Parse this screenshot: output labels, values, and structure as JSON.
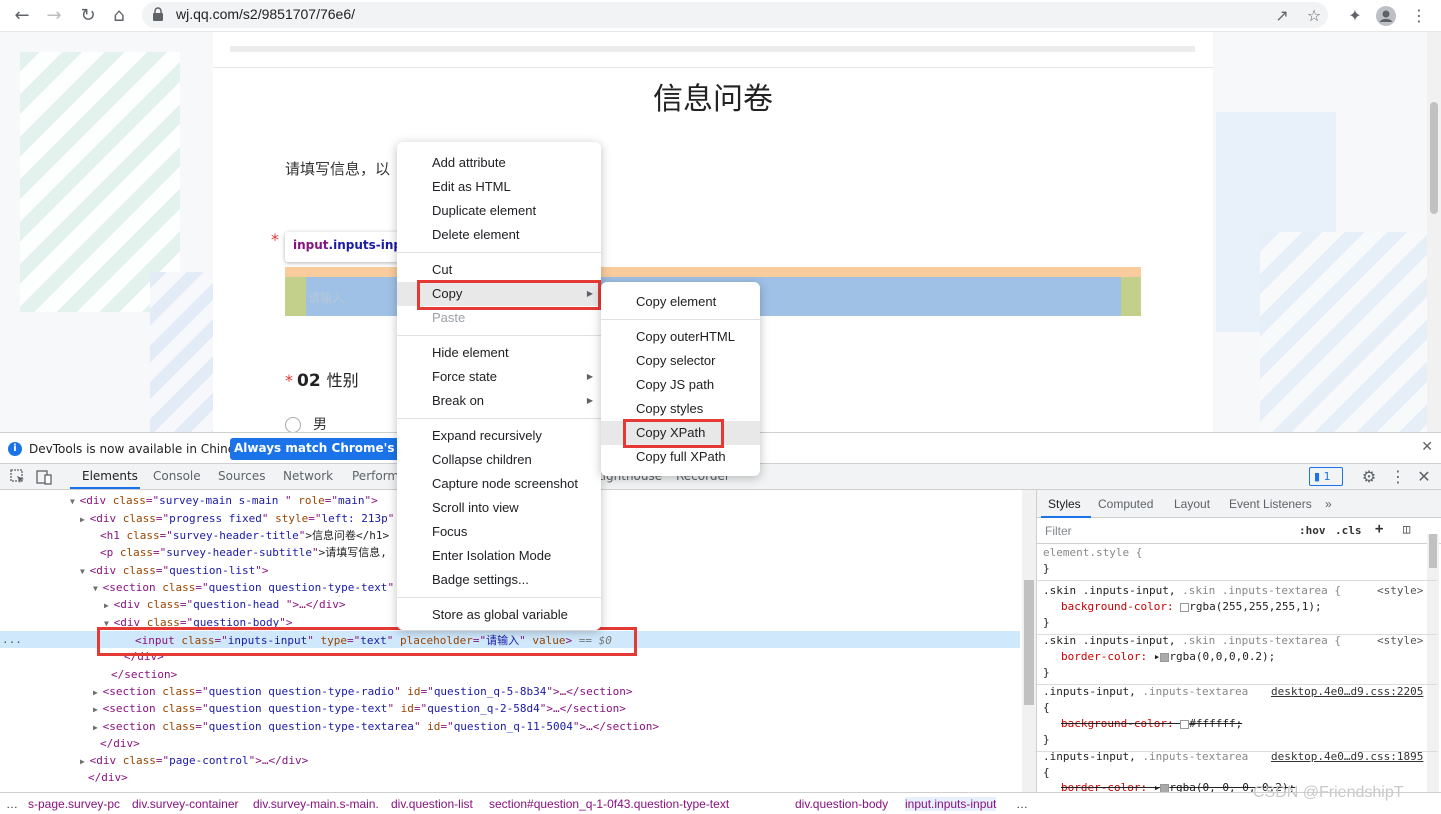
{
  "browser": {
    "url": "wj.qq.com/s2/9851707/76e6/"
  },
  "page": {
    "title": "信息问卷",
    "subtitle": "请填写信息，以",
    "input_placeholder": "请输入",
    "tooltip_tag": "input",
    "tooltip_class": ".inputs-inpu",
    "q2_number": "02",
    "q2_title": "性别",
    "q2_option": "男",
    "required_mark": "*"
  },
  "infobar": {
    "message": "DevTools is now available in Chinese!",
    "button": "Always match Chrome's language"
  },
  "devtools": {
    "tabs": [
      "Elements",
      "Console",
      "Sources",
      "Network",
      "Performa",
      "Lighthouse",
      "Recorder"
    ],
    "issues_count": "1",
    "dom_lines": [
      {
        "open": "<",
        "tag": "div",
        "attrs": [
          [
            "class",
            "survey-main s-main "
          ],
          [
            "role",
            "main"
          ]
        ],
        "tail": ">"
      },
      {
        "open": "<",
        "tag": "div",
        "attrs": [
          [
            "class",
            "progress fixed"
          ],
          [
            "style",
            "left: 213p"
          ]
        ],
        "tail": ""
      },
      {
        "open": "<",
        "tag": "h1",
        "attrs": [
          [
            "class",
            "survey-header-title"
          ]
        ],
        "tail": ">信息问卷</h1>"
      },
      {
        "open": "<",
        "tag": "p",
        "attrs": [
          [
            "class",
            "survey-header-subtitle"
          ]
        ],
        "tail": ">请填写信息,"
      },
      {
        "open": "<",
        "tag": "div",
        "attrs": [
          [
            "class",
            "question-list"
          ]
        ],
        "tail": ">"
      },
      {
        "open": "<",
        "tag": "section",
        "attrs": [
          [
            "class",
            "question question-type-text"
          ]
        ],
        "tail": ""
      },
      {
        "open": "<",
        "tag": "div",
        "attrs": [
          [
            "class",
            "question-head "
          ]
        ],
        "tail": ">…</div>"
      },
      {
        "open": "<",
        "tag": "div",
        "attrs": [
          [
            "class",
            "question-body"
          ]
        ],
        "tail": ">"
      },
      {
        "open": "<",
        "tag": "input",
        "attrs": [
          [
            "class",
            "inputs-input"
          ],
          [
            "type",
            "text"
          ],
          [
            "placeholder",
            "请输入"
          ],
          [
            "value",
            ""
          ]
        ],
        "tail": "> == $0"
      },
      {
        "open": "</",
        "tag": "div",
        "attrs": [],
        "tail": ">"
      },
      {
        "open": "</",
        "tag": "section",
        "attrs": [],
        "tail": ">"
      },
      {
        "open": "<",
        "tag": "section",
        "attrs": [
          [
            "class",
            "question question-type-radio"
          ],
          [
            "id",
            "question_q-5-8b34"
          ]
        ],
        "tail": ">…</section>"
      },
      {
        "open": "<",
        "tag": "section",
        "attrs": [
          [
            "class",
            "question question-type-text"
          ],
          [
            "id",
            "question_q-2-58d4"
          ]
        ],
        "tail": ">…</section>"
      },
      {
        "open": "<",
        "tag": "section",
        "attrs": [
          [
            "class",
            "question question-type-textarea"
          ],
          [
            "id",
            "question_q-11-5004"
          ]
        ],
        "tail": ">…</section>"
      },
      {
        "open": "</",
        "tag": "div",
        "attrs": [],
        "tail": ">"
      },
      {
        "open": "<",
        "tag": "div",
        "attrs": [
          [
            "class",
            "page-control"
          ]
        ],
        "tail": ">…</div>"
      },
      {
        "open": "</",
        "tag": "div",
        "attrs": [],
        "tail": ">"
      }
    ],
    "styles_tabs": [
      "Styles",
      "Computed",
      "Layout",
      "Event Listeners"
    ],
    "filter_placeholder": "Filter",
    "hov": ":hov",
    "cls": ".cls",
    "rules": {
      "r0_sel": "element.style {",
      "r0_end": "}",
      "r1_sel_a": ".skin .inputs-input,",
      "r1_sel_b": ".skin .inputs-textarea {",
      "r1_src": "<style>",
      "r1_prop": "background-color:",
      "r1_val": "rgba(255,255,255,1);",
      "r2_sel_a": ".skin .inputs-input,",
      "r2_sel_b": ".skin .inputs-textarea {",
      "r2_src": "<style>",
      "r2_prop": "border-color:",
      "r2_val": "rgba(0,0,0,0.2);",
      "r3_sel_a": ".inputs-input,",
      "r3_sel_b": ".inputs-textarea",
      "r3_src": "desktop.4e0…d9.css:2205",
      "r3_prop": "background-color:",
      "r3_val": "#ffffff;",
      "r4_sel_a": ".inputs-input,",
      "r4_sel_b": ".inputs-textarea",
      "r4_src": "desktop.4e0…d9.css:1895",
      "r4_prop": "border-color:",
      "r4_val": "rgba(0, 0, 0, 0.2);",
      "brace_open": "{",
      "brace_close": "}"
    },
    "breadcrumbs": [
      "…",
      "s-page.survey-pc",
      "div.survey-container",
      "div.survey-main.s-main.",
      "div.question-list",
      "section#question_q-1-0f43.question-type-text",
      "div.question-body",
      "input.inputs-input",
      "…"
    ]
  },
  "context_menu": {
    "items": [
      "Add attribute",
      "Edit as HTML",
      "Duplicate element",
      "Delete element",
      "Cut",
      "Copy",
      "Paste",
      "Hide element",
      "Force state",
      "Break on",
      "Expand recursively",
      "Collapse children",
      "Capture node screenshot",
      "Scroll into view",
      "Focus",
      "Enter Isolation Mode",
      "Badge settings...",
      "Store as global variable"
    ],
    "copy_submenu": [
      "Copy element",
      "Copy outerHTML",
      "Copy selector",
      "Copy JS path",
      "Copy styles",
      "Copy XPath",
      "Copy full XPath"
    ]
  },
  "watermark": "CSDN @FriendshipT",
  "colors": {
    "accent": "#1a73e8",
    "highlight_red": "#e53935",
    "margin_overlay": "#f9cc9d",
    "content_overlay": "#9fc1e6"
  }
}
